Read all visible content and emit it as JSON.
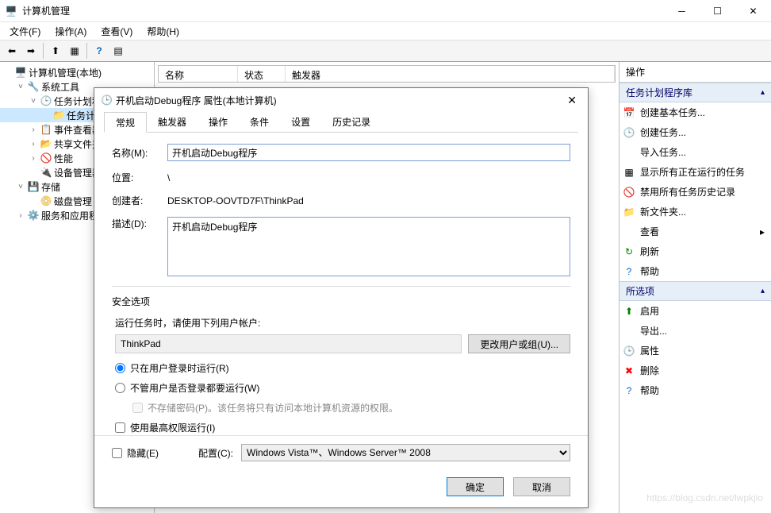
{
  "window": {
    "title": "计算机管理",
    "watermark": "https://blog.csdn.net/lwpkjio"
  },
  "menus": {
    "file": "文件(F)",
    "action": "操作(A)",
    "view": "查看(V)",
    "help": "帮助(H)"
  },
  "tree": {
    "root": "计算机管理(本地)",
    "sys_tools": "系统工具",
    "task_sched": "任务计划程",
    "task_lib": "任务计",
    "event_viewer": "事件查看器",
    "shared": "共享文件夹",
    "perf": "性能",
    "devmgr": "设备管理器",
    "storage": "存储",
    "diskmgr": "磁盘管理",
    "services": "服务和应用程"
  },
  "list_headers": {
    "name": "名称",
    "status": "状态",
    "triggers": "触发器"
  },
  "actions": {
    "header": "操作",
    "section1": "任务计划程序库",
    "items1": [
      "创建基本任务...",
      "创建任务...",
      "导入任务...",
      "显示所有正在运行的任务",
      "禁用所有任务历史记录",
      "新文件夹...",
      "查看",
      "刷新",
      "帮助"
    ],
    "section2": "所选项",
    "items2": [
      "启用",
      "导出...",
      "属性",
      "删除",
      "帮助"
    ]
  },
  "dialog": {
    "title": "开机启动Debug程序 属性(本地计算机)",
    "tabs": [
      "常规",
      "触发器",
      "操作",
      "条件",
      "设置",
      "历史记录"
    ],
    "name_label": "名称(M):",
    "name_value": "开机启动Debug程序",
    "location_label": "位置:",
    "location_value": "\\",
    "creator_label": "创建者:",
    "creator_value": "DESKTOP-OOVTD7F\\ThinkPad",
    "desc_label": "描述(D):",
    "desc_value": "开机启动Debug程序",
    "security_label": "安全选项",
    "security_prompt": "运行任务时，请使用下列用户帐户:",
    "user": "ThinkPad",
    "change_user_btn": "更改用户或组(U)...",
    "radio1": "只在用户登录时运行(R)",
    "radio2": "不管用户是否登录都要运行(W)",
    "check_nopwd": "不存储密码(P)。该任务将只有访问本地计算机资源的权限。",
    "check_highest": "使用最高权限运行(I)",
    "hidden": "隐藏(E)",
    "config_label": "配置(C):",
    "config_value": "Windows Vista™、Windows Server™ 2008",
    "ok": "确定",
    "cancel": "取消"
  }
}
